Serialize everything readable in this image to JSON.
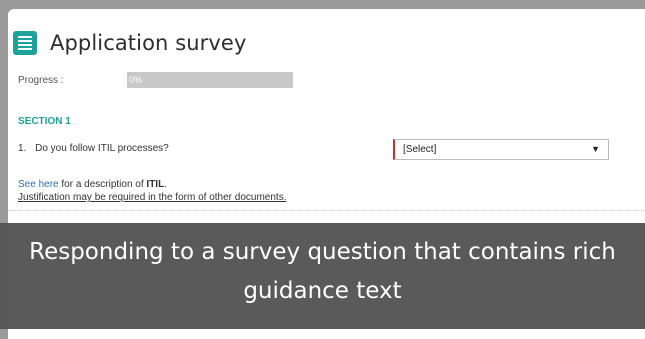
{
  "survey": {
    "title": "Application survey",
    "progress_label": "Progress :",
    "progress_text": "0%",
    "progress_value": 0,
    "section_title": "SECTION 1",
    "question_number": "1.",
    "question_text": "Do you follow ITIL processes?",
    "select_value": "[Select]",
    "guidance_link": "See here",
    "guidance_text": " for a description of ",
    "guidance_bold": "ITIL",
    "guidance_period": ".",
    "justification": "Justification may be required in the form of other documents."
  },
  "caption": {
    "line1": "Responding to a survey question that contains rich",
    "line2": "guidance text"
  },
  "colors": {
    "accent": "#1aa39a",
    "required": "#d9242b",
    "link": "#2a6ebb",
    "overlay": "#555555"
  },
  "icons": {
    "app": "list-icon",
    "dropdown": "triangle-down-icon"
  }
}
